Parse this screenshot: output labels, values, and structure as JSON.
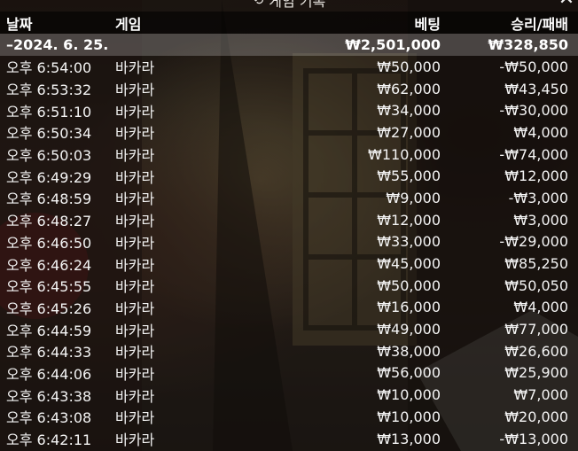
{
  "title": "게임 기록",
  "columns": {
    "date": "날짜",
    "game": "게임",
    "bet": "베팅",
    "result": "승리/패배"
  },
  "date_group": {
    "date": "–2024. 6. 25.",
    "total_bet": "₩2,501,000",
    "total_result": "₩328,850"
  },
  "rows": [
    {
      "time": "오후 6:54:00",
      "game": "바카라",
      "bet": "₩50,000",
      "result": "-₩50,000"
    },
    {
      "time": "오후 6:53:32",
      "game": "바카라",
      "bet": "₩62,000",
      "result": "₩43,450"
    },
    {
      "time": "오후 6:51:10",
      "game": "바카라",
      "bet": "₩34,000",
      "result": "-₩30,000"
    },
    {
      "time": "오후 6:50:34",
      "game": "바카라",
      "bet": "₩27,000",
      "result": "₩4,000"
    },
    {
      "time": "오후 6:50:03",
      "game": "바카라",
      "bet": "₩110,000",
      "result": "-₩74,000"
    },
    {
      "time": "오후 6:49:29",
      "game": "바카라",
      "bet": "₩55,000",
      "result": "₩12,000"
    },
    {
      "time": "오후 6:48:59",
      "game": "바카라",
      "bet": "₩9,000",
      "result": "-₩3,000"
    },
    {
      "time": "오후 6:48:27",
      "game": "바카라",
      "bet": "₩12,000",
      "result": "₩3,000"
    },
    {
      "time": "오후 6:46:50",
      "game": "바카라",
      "bet": "₩33,000",
      "result": "-₩29,000"
    },
    {
      "time": "오후 6:46:24",
      "game": "바카라",
      "bet": "₩45,000",
      "result": "₩85,250"
    },
    {
      "time": "오후 6:45:55",
      "game": "바카라",
      "bet": "₩50,000",
      "result": "₩50,050"
    },
    {
      "time": "오후 6:45:26",
      "game": "바카라",
      "bet": "₩16,000",
      "result": "₩4,000"
    },
    {
      "time": "오후 6:44:59",
      "game": "바카라",
      "bet": "₩49,000",
      "result": "₩77,000"
    },
    {
      "time": "오후 6:44:33",
      "game": "바카라",
      "bet": "₩38,000",
      "result": "₩26,600"
    },
    {
      "time": "오후 6:44:06",
      "game": "바카라",
      "bet": "₩56,000",
      "result": "₩25,900"
    },
    {
      "time": "오후 6:43:38",
      "game": "바카라",
      "bet": "₩10,000",
      "result": "₩7,000"
    },
    {
      "time": "오후 6:43:08",
      "game": "바카라",
      "bet": "₩10,000",
      "result": "₩20,000"
    },
    {
      "time": "오후 6:42:11",
      "game": "바카라",
      "bet": "₩13,000",
      "result": "-₩13,000"
    }
  ],
  "icons": {
    "title_icon": "history-icon",
    "close": "close-icon"
  }
}
